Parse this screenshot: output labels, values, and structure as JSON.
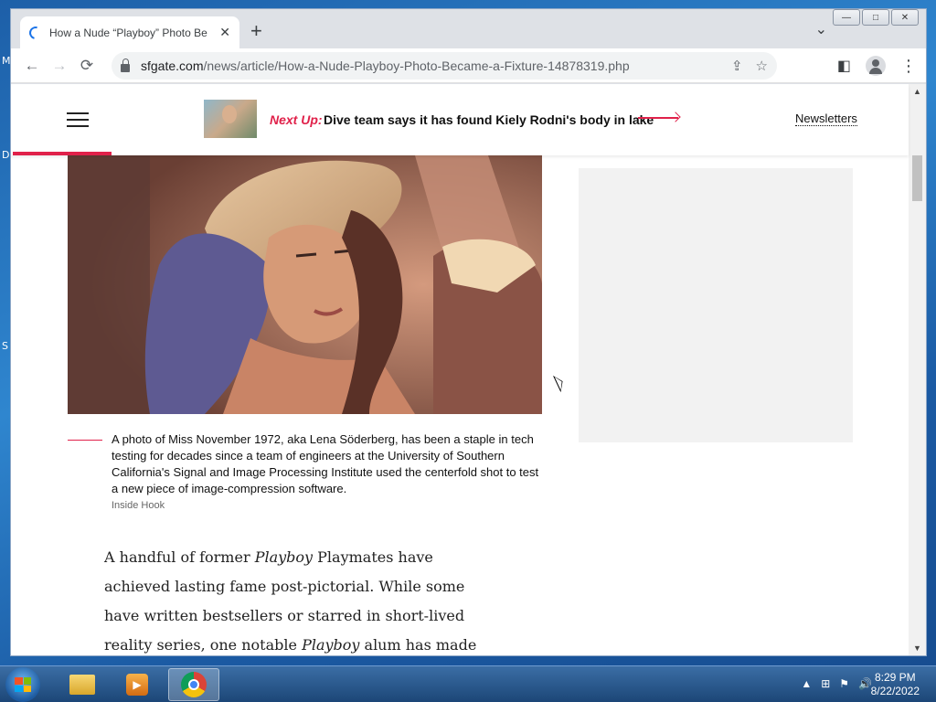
{
  "desktop": {
    "letters": [
      "M",
      "D",
      "S"
    ]
  },
  "window": {
    "caption_buttons": [
      "—",
      "□",
      "✕"
    ]
  },
  "tab": {
    "title": "How a Nude “Playboy” Photo Be",
    "close": "✕",
    "new_tab": "+",
    "tab_search": "⌄"
  },
  "toolbar": {
    "back": "←",
    "forward": "→",
    "reload": "⟳",
    "url_host": "sfgate.com",
    "url_path": "/news/article/How-a-Nude-Playboy-Photo-Became-a-Fixture-14878319.php",
    "share": "⇪",
    "bookmark": "☆",
    "sidepanel": "◧",
    "menu": "⋮"
  },
  "site_header": {
    "next_up_label": "Next Up:",
    "next_up_title": "Dive team says it has found Kiely Rodni's body in lake",
    "newsletters": "Newsletters",
    "reading_progress": 0.11
  },
  "figure": {
    "caption": "A photo of Miss November 1972, aka Lena Söderberg, has been a staple in tech testing for decades since a team of engineers at the University of Southern California's Signal and Image Processing Institute used the centerfold shot to test a new piece of image-compression software.",
    "credit": "Inside Hook"
  },
  "article": {
    "p1_a": "A handful of former ",
    "p1_i1": "Playboy",
    "p1_b": " Playmates have achieved lasting fame post-pictorial. While some have written bestsellers or starred in short-lived reality series, one notable ",
    "p1_i2": "Playboy",
    "p1_c": " alum has made"
  },
  "scrollbar": {
    "up": "▲",
    "down": "▼"
  },
  "taskbar": {
    "tray_icons": [
      "▲",
      "⊞",
      "⚑",
      "🔊"
    ],
    "time": "8:29 PM",
    "date": "8/22/2022"
  }
}
